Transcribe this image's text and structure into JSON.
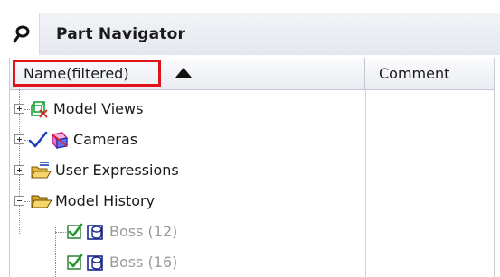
{
  "panel": {
    "title": "Part Navigator",
    "icon": "pin-icon"
  },
  "columns": {
    "name_header": "Name(filtered)",
    "comment_header": "Comment",
    "sort": "ascending"
  },
  "tree": [
    {
      "label": "Model Views",
      "icon": "model-views-icon",
      "expander": "plus",
      "level": 0,
      "dim": false
    },
    {
      "label": "Cameras",
      "icon": "camera-icon",
      "expander": "plus",
      "level": 0,
      "checked": true,
      "dim": false
    },
    {
      "label": "User Expressions",
      "icon": "folder-expressions-icon",
      "expander": "plus",
      "level": 0,
      "dim": false
    },
    {
      "label": "Model History",
      "icon": "folder-open-icon",
      "expander": "minus",
      "level": 0,
      "dim": false
    },
    {
      "label": "Boss (12)",
      "icon": "boss-feature-icon",
      "level": 1,
      "checked": true,
      "dim": true
    },
    {
      "label": "Boss (16)",
      "icon": "boss-feature-icon",
      "level": 1,
      "checked": true,
      "dim": true
    }
  ],
  "colors": {
    "highlight_border": "#e0131c",
    "check_green": "#1f9a2a",
    "folder_yellow": "#e8c43a"
  }
}
